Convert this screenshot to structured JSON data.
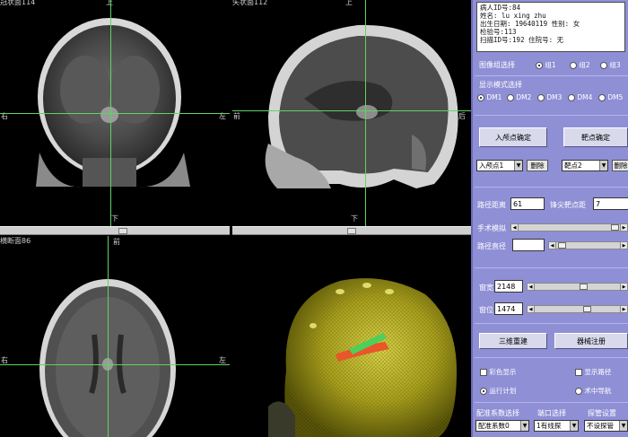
{
  "views": {
    "coronal_label": "冠状面114",
    "sagittal_label": "矢状面112",
    "axial_label": "横断面86",
    "dir_top": "上",
    "dir_bottom": "下",
    "dir_right": "右",
    "dir_left": "左",
    "dir_front": "前",
    "dir_back": "后"
  },
  "patient": {
    "id_line": "病人ID号:84",
    "name_line": "姓名: lu xing zhu",
    "birth_line": "出生日期:  19640119 性别: 女",
    "exam_line": "检验号:113",
    "scan_line": "扫描ID号:192 住院号: 无"
  },
  "image_group": {
    "label": "图像组选择",
    "options": [
      "组1",
      "组2",
      "组3"
    ],
    "selected": 0
  },
  "display_mode": {
    "label": "显示模式选择",
    "options": [
      "DM1",
      "DM2",
      "DM3",
      "DM4",
      "DM5"
    ],
    "selected": 0
  },
  "points": {
    "entry_button": "入颅点确定",
    "target_button": "靶点确定",
    "entry_select": "入颅点1",
    "target_select": "靶点2",
    "delete_label": "删除"
  },
  "path": {
    "distance_label": "路径距离",
    "distance_value": "61",
    "tip_label": "锋尖靶点距",
    "tip_value": "7",
    "simulation_label": "手术模拟",
    "diameter_label": "路径直径",
    "diameter_value": ""
  },
  "window": {
    "width_label": "窗宽",
    "width_value": "2148",
    "level_label": "窗位",
    "level_value": "1474"
  },
  "actions": {
    "reconstruct_button": "三维重建",
    "register_button": "器械注册"
  },
  "options": {
    "color_display": "彩色显示",
    "show_trajectory": "显示路径",
    "run_plan": "运行计划",
    "intraop_nav": "术中导航"
  },
  "bottom": {
    "header_coord": "配准系数选择",
    "header_port": "端口选择",
    "header_probe": "探管设置",
    "coord_value": "配准系数0",
    "port_value": "1有线探",
    "probe_value": "不设探管"
  }
}
